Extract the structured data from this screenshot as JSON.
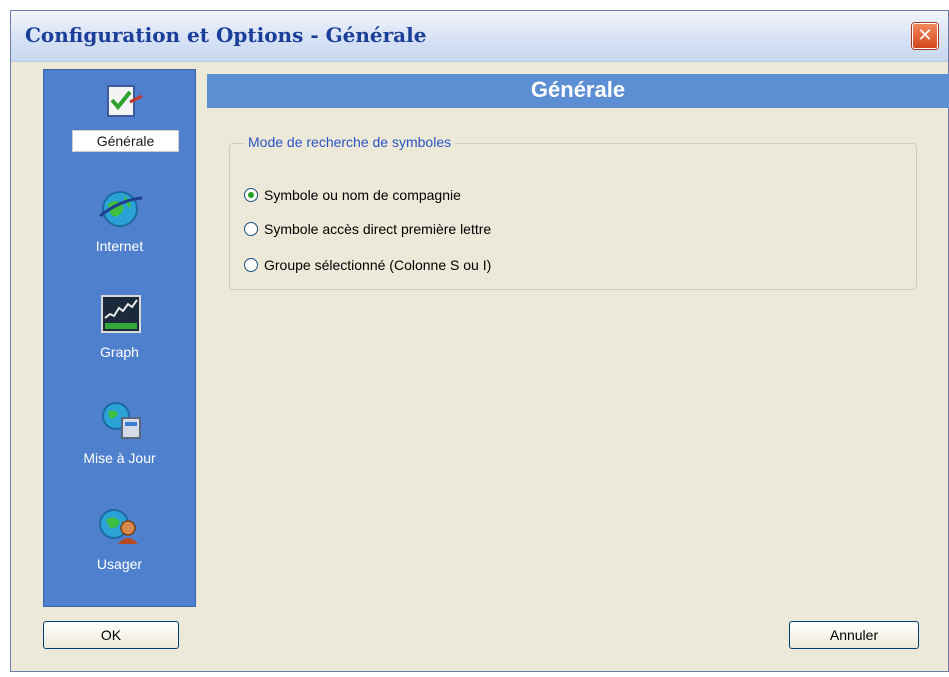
{
  "window": {
    "title": "Configuration et Options - Générale",
    "close_symbol": "✕"
  },
  "sidebar": {
    "items": [
      {
        "label": "Générale",
        "icon": "checklist-icon",
        "active": true
      },
      {
        "label": "Internet",
        "icon": "globe-icon",
        "active": false
      },
      {
        "label": "Graph",
        "icon": "chart-icon",
        "active": false
      },
      {
        "label": "Mise à Jour",
        "icon": "update-icon",
        "active": false
      },
      {
        "label": "Usager",
        "icon": "user-icon",
        "active": false
      }
    ]
  },
  "panel": {
    "title": "Générale",
    "group_title": "Mode de recherche de symboles",
    "options": [
      {
        "label": "Symbole ou nom de compagnie",
        "selected": true
      },
      {
        "label": "Symbole accès direct première lettre",
        "selected": false
      },
      {
        "label": "Groupe sélectionné (Colonne S ou I)",
        "selected": false
      }
    ]
  },
  "buttons": {
    "ok": "OK",
    "cancel": "Annuler"
  },
  "colors": {
    "sidebar_bg": "#4f80cd",
    "header_bg": "#5b8ed3",
    "title_text": "#1b3f98",
    "window_bg": "#ece9d8"
  }
}
